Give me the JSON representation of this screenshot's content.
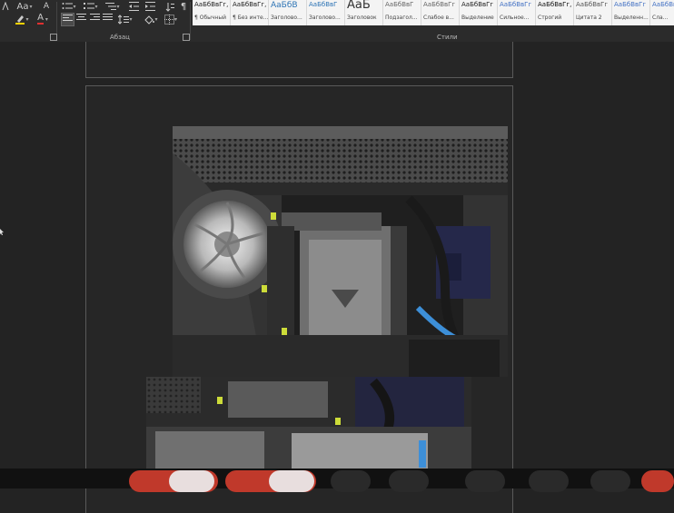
{
  "ribbon": {
    "font_size_label": "Aa",
    "clear_format_label": "A",
    "font_color_label": "A",
    "highlight_label": "ab",
    "group_paragraph": "Абзац",
    "group_styles": "Стили",
    "styles": [
      {
        "sample": "АаБбВвГг,",
        "name": "¶ Обычный",
        "color": "#222222"
      },
      {
        "sample": "АаБбВвГг,",
        "name": "¶ Без инте...",
        "color": "#222222"
      },
      {
        "sample": "АаБбВ",
        "name": "Заголово...",
        "color": "#2e74b5"
      },
      {
        "sample": "АаБбВвГ",
        "name": "Заголово...",
        "color": "#2e74b5"
      },
      {
        "sample": "АаБ",
        "name": "Заголовок",
        "color": "#333333"
      },
      {
        "sample": "АаБбВвГ",
        "name": "Подзагол...",
        "color": "#666666"
      },
      {
        "sample": "АаБбВвГг",
        "name": "Слабое в...",
        "color": "#666666"
      },
      {
        "sample": "АаБбВвГг",
        "name": "Выделение",
        "color": "#222222"
      },
      {
        "sample": "АаБбВвГг",
        "name": "Сильное...",
        "color": "#4472c4"
      },
      {
        "sample": "АаБбВвГг,",
        "name": "Строгий",
        "color": "#111111"
      },
      {
        "sample": "АаБбВвГг",
        "name": "Цитата 2",
        "color": "#555555"
      },
      {
        "sample": "АаБбВвГг",
        "name": "Выделенн...",
        "color": "#4472c4"
      },
      {
        "sample": "АаБбВвГг",
        "name": "Сла...",
        "color": "#4472c4"
      }
    ]
  },
  "colors": {
    "highlight": "#ffd200",
    "font_color": "#e03030",
    "accent": "#4472c4",
    "taskbar_red": "#c0392b"
  }
}
